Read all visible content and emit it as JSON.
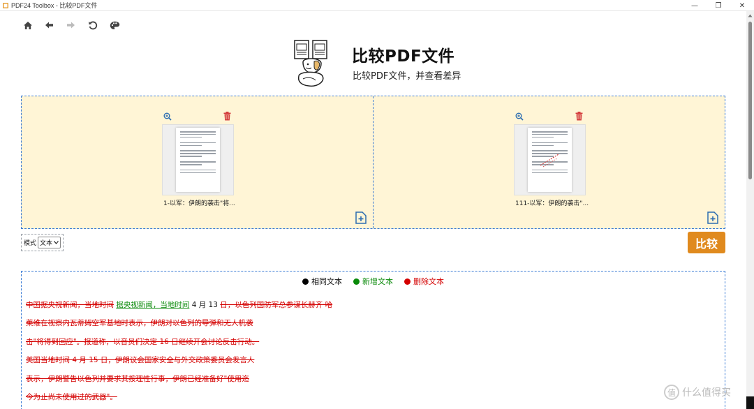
{
  "window": {
    "title": "PDF24 Toolbox - 比较PDF文件",
    "minimize": "—",
    "maximize": "❐",
    "close": "✕"
  },
  "nav": {
    "items": [
      {
        "name": "home-button",
        "icon": "home-icon",
        "enabled": true
      },
      {
        "name": "back-button",
        "icon": "arrow-left-icon",
        "enabled": true
      },
      {
        "name": "forward-button",
        "icon": "arrow-right-icon",
        "enabled": false
      },
      {
        "name": "reload-button",
        "icon": "undo-icon",
        "enabled": true
      },
      {
        "name": "theme-button",
        "icon": "palette-icon",
        "enabled": true
      }
    ]
  },
  "header": {
    "title": "比较PDF文件",
    "subtitle": "比较PDF文件，并查看差异"
  },
  "files": [
    {
      "name": "1-以军：伊朗的袭击\"将..."
    },
    {
      "name": "111-以军：伊朗的袭击\"..."
    }
  ],
  "mode": {
    "label": "模式",
    "selected": "文本"
  },
  "compare_button": "比较",
  "legend": {
    "same": "相同文本",
    "added": "新增文本",
    "deleted": "删除文本",
    "colors": {
      "same": "#000000",
      "added": "#0a8a0a",
      "deleted": "#d40000"
    }
  },
  "diff": [
    [
      {
        "type": "del",
        "text": "中国据央视新闻，当地时间"
      },
      {
        "type": "add",
        "text": "据央视新闻，当地时间"
      },
      {
        "type": "same",
        "text": "4 月 13 "
      },
      {
        "type": "del",
        "text": "日，以色列国防军总参谋长赫齐·哈"
      }
    ],
    [
      {
        "type": "del",
        "text": "莱维在视察内瓦蒂姆空军基地时表示，伊朗对以色列的导弹和无人机袭"
      }
    ],
    [
      {
        "type": "del",
        "text": "击\"将得到回应\"。报道称，以音员们决定 16 日继续开会讨论反击行动。"
      }
    ],
    [
      {
        "type": "del",
        "text": "美国当地时间 4 月 15 日，伊朗议会国家安全与外交政策委员会发言人"
      }
    ],
    [
      {
        "type": "del",
        "text": "表示，伊朗警告以色列并要求其按理性行事，伊朗已经准备好\"使用迄"
      }
    ],
    [
      {
        "type": "del",
        "text": "今为止尚未使用过的武器\"。"
      }
    ]
  ],
  "watermark": {
    "glyph": "值",
    "text": "什么值得买"
  }
}
